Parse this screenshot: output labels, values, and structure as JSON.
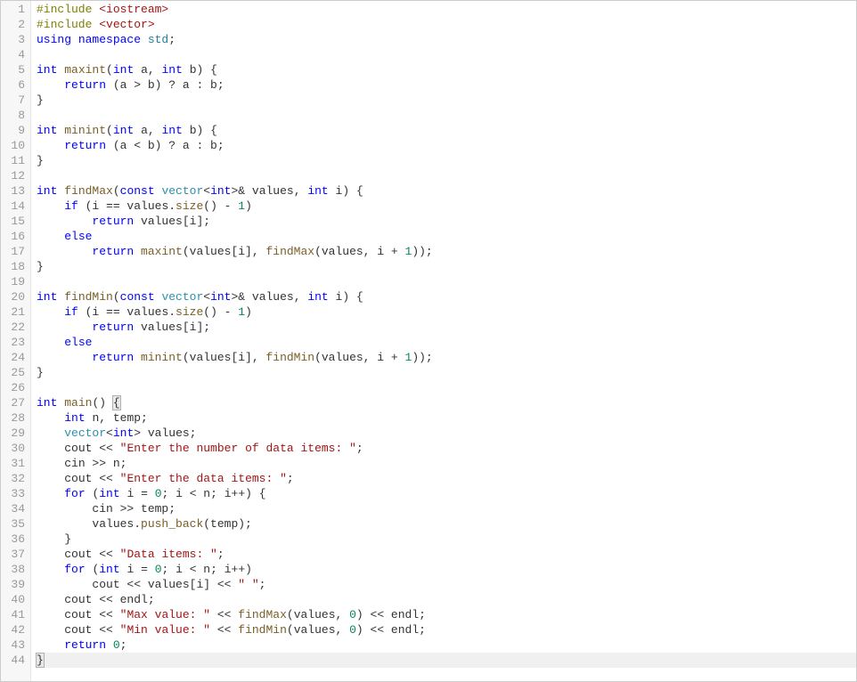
{
  "editor": {
    "line_count": 44,
    "highlighted_line": 44,
    "brace_match_lines": [
      27,
      44
    ],
    "lines": [
      [
        {
          "t": "#include ",
          "c": "preproc"
        },
        {
          "t": "<iostream>",
          "c": "string"
        }
      ],
      [
        {
          "t": "#include ",
          "c": "preproc"
        },
        {
          "t": "<vector>",
          "c": "string"
        }
      ],
      [
        {
          "t": "using ",
          "c": "keyword"
        },
        {
          "t": "namespace ",
          "c": "keyword"
        },
        {
          "t": "std",
          "c": "namespace"
        },
        {
          "t": ";",
          "c": "punct"
        }
      ],
      [],
      [
        {
          "t": "int ",
          "c": "keyword"
        },
        {
          "t": "maxint",
          "c": "func"
        },
        {
          "t": "(",
          "c": "paren"
        },
        {
          "t": "int ",
          "c": "keyword"
        },
        {
          "t": "a",
          "c": "ident"
        },
        {
          "t": ", ",
          "c": "punct"
        },
        {
          "t": "int ",
          "c": "keyword"
        },
        {
          "t": "b",
          "c": "ident"
        },
        {
          "t": ") {",
          "c": "paren"
        }
      ],
      [
        {
          "t": "    ",
          "c": "ident"
        },
        {
          "t": "return ",
          "c": "keyword"
        },
        {
          "t": "(a > b) ? a : b;",
          "c": "ident"
        }
      ],
      [
        {
          "t": "}",
          "c": "paren"
        }
      ],
      [],
      [
        {
          "t": "int ",
          "c": "keyword"
        },
        {
          "t": "minint",
          "c": "func"
        },
        {
          "t": "(",
          "c": "paren"
        },
        {
          "t": "int ",
          "c": "keyword"
        },
        {
          "t": "a",
          "c": "ident"
        },
        {
          "t": ", ",
          "c": "punct"
        },
        {
          "t": "int ",
          "c": "keyword"
        },
        {
          "t": "b",
          "c": "ident"
        },
        {
          "t": ") {",
          "c": "paren"
        }
      ],
      [
        {
          "t": "    ",
          "c": "ident"
        },
        {
          "t": "return ",
          "c": "keyword"
        },
        {
          "t": "(a < b) ? a : b;",
          "c": "ident"
        }
      ],
      [
        {
          "t": "}",
          "c": "paren"
        }
      ],
      [],
      [
        {
          "t": "int ",
          "c": "keyword"
        },
        {
          "t": "findMax",
          "c": "func"
        },
        {
          "t": "(",
          "c": "paren"
        },
        {
          "t": "const ",
          "c": "keyword"
        },
        {
          "t": "vector",
          "c": "type"
        },
        {
          "t": "<",
          "c": "op"
        },
        {
          "t": "int",
          "c": "keyword"
        },
        {
          "t": ">& ",
          "c": "op"
        },
        {
          "t": "values",
          "c": "ident"
        },
        {
          "t": ", ",
          "c": "punct"
        },
        {
          "t": "int ",
          "c": "keyword"
        },
        {
          "t": "i",
          "c": "ident"
        },
        {
          "t": ") {",
          "c": "paren"
        }
      ],
      [
        {
          "t": "    ",
          "c": "ident"
        },
        {
          "t": "if ",
          "c": "keyword"
        },
        {
          "t": "(i == values.",
          "c": "ident"
        },
        {
          "t": "size",
          "c": "func"
        },
        {
          "t": "() - ",
          "c": "ident"
        },
        {
          "t": "1",
          "c": "num"
        },
        {
          "t": ")",
          "c": "paren"
        }
      ],
      [
        {
          "t": "        ",
          "c": "ident"
        },
        {
          "t": "return ",
          "c": "keyword"
        },
        {
          "t": "values[i];",
          "c": "ident"
        }
      ],
      [
        {
          "t": "    ",
          "c": "ident"
        },
        {
          "t": "else",
          "c": "keyword"
        }
      ],
      [
        {
          "t": "        ",
          "c": "ident"
        },
        {
          "t": "return ",
          "c": "keyword"
        },
        {
          "t": "maxint",
          "c": "func"
        },
        {
          "t": "(values[i], ",
          "c": "ident"
        },
        {
          "t": "findMax",
          "c": "func"
        },
        {
          "t": "(values, i + ",
          "c": "ident"
        },
        {
          "t": "1",
          "c": "num"
        },
        {
          "t": "));",
          "c": "paren"
        }
      ],
      [
        {
          "t": "}",
          "c": "paren"
        }
      ],
      [],
      [
        {
          "t": "int ",
          "c": "keyword"
        },
        {
          "t": "findMin",
          "c": "func"
        },
        {
          "t": "(",
          "c": "paren"
        },
        {
          "t": "const ",
          "c": "keyword"
        },
        {
          "t": "vector",
          "c": "type"
        },
        {
          "t": "<",
          "c": "op"
        },
        {
          "t": "int",
          "c": "keyword"
        },
        {
          "t": ">& ",
          "c": "op"
        },
        {
          "t": "values",
          "c": "ident"
        },
        {
          "t": ", ",
          "c": "punct"
        },
        {
          "t": "int ",
          "c": "keyword"
        },
        {
          "t": "i",
          "c": "ident"
        },
        {
          "t": ") {",
          "c": "paren"
        }
      ],
      [
        {
          "t": "    ",
          "c": "ident"
        },
        {
          "t": "if ",
          "c": "keyword"
        },
        {
          "t": "(i == values.",
          "c": "ident"
        },
        {
          "t": "size",
          "c": "func"
        },
        {
          "t": "() - ",
          "c": "ident"
        },
        {
          "t": "1",
          "c": "num"
        },
        {
          "t": ")",
          "c": "paren"
        }
      ],
      [
        {
          "t": "        ",
          "c": "ident"
        },
        {
          "t": "return ",
          "c": "keyword"
        },
        {
          "t": "values[i];",
          "c": "ident"
        }
      ],
      [
        {
          "t": "    ",
          "c": "ident"
        },
        {
          "t": "else",
          "c": "keyword"
        }
      ],
      [
        {
          "t": "        ",
          "c": "ident"
        },
        {
          "t": "return ",
          "c": "keyword"
        },
        {
          "t": "minint",
          "c": "func"
        },
        {
          "t": "(values[i], ",
          "c": "ident"
        },
        {
          "t": "findMin",
          "c": "func"
        },
        {
          "t": "(values, i + ",
          "c": "ident"
        },
        {
          "t": "1",
          "c": "num"
        },
        {
          "t": "));",
          "c": "paren"
        }
      ],
      [
        {
          "t": "}",
          "c": "paren"
        }
      ],
      [],
      [
        {
          "t": "int ",
          "c": "keyword"
        },
        {
          "t": "main",
          "c": "func"
        },
        {
          "t": "() ",
          "c": "paren"
        },
        {
          "t": "{",
          "c": "paren",
          "bm": true
        }
      ],
      [
        {
          "t": "    ",
          "c": "ident"
        },
        {
          "t": "int ",
          "c": "keyword"
        },
        {
          "t": "n, temp;",
          "c": "ident"
        }
      ],
      [
        {
          "t": "    ",
          "c": "ident"
        },
        {
          "t": "vector",
          "c": "type"
        },
        {
          "t": "<",
          "c": "op"
        },
        {
          "t": "int",
          "c": "keyword"
        },
        {
          "t": "> ",
          "c": "op"
        },
        {
          "t": "values;",
          "c": "ident"
        }
      ],
      [
        {
          "t": "    ",
          "c": "ident"
        },
        {
          "t": "cout << ",
          "c": "ident"
        },
        {
          "t": "\"Enter the number of data items: \"",
          "c": "string"
        },
        {
          "t": ";",
          "c": "punct"
        }
      ],
      [
        {
          "t": "    ",
          "c": "ident"
        },
        {
          "t": "cin >> n;",
          "c": "ident"
        }
      ],
      [
        {
          "t": "    ",
          "c": "ident"
        },
        {
          "t": "cout << ",
          "c": "ident"
        },
        {
          "t": "\"Enter the data items: \"",
          "c": "string"
        },
        {
          "t": ";",
          "c": "punct"
        }
      ],
      [
        {
          "t": "    ",
          "c": "ident"
        },
        {
          "t": "for ",
          "c": "keyword"
        },
        {
          "t": "(",
          "c": "paren"
        },
        {
          "t": "int ",
          "c": "keyword"
        },
        {
          "t": "i = ",
          "c": "ident"
        },
        {
          "t": "0",
          "c": "num"
        },
        {
          "t": "; i < n; i++) {",
          "c": "ident"
        }
      ],
      [
        {
          "t": "        ",
          "c": "ident"
        },
        {
          "t": "cin >> temp;",
          "c": "ident"
        }
      ],
      [
        {
          "t": "        ",
          "c": "ident"
        },
        {
          "t": "values.",
          "c": "ident"
        },
        {
          "t": "push_back",
          "c": "func"
        },
        {
          "t": "(temp);",
          "c": "ident"
        }
      ],
      [
        {
          "t": "    }",
          "c": "paren"
        }
      ],
      [
        {
          "t": "    ",
          "c": "ident"
        },
        {
          "t": "cout << ",
          "c": "ident"
        },
        {
          "t": "\"Data items: \"",
          "c": "string"
        },
        {
          "t": ";",
          "c": "punct"
        }
      ],
      [
        {
          "t": "    ",
          "c": "ident"
        },
        {
          "t": "for ",
          "c": "keyword"
        },
        {
          "t": "(",
          "c": "paren"
        },
        {
          "t": "int ",
          "c": "keyword"
        },
        {
          "t": "i = ",
          "c": "ident"
        },
        {
          "t": "0",
          "c": "num"
        },
        {
          "t": "; i < n; i++)",
          "c": "ident"
        }
      ],
      [
        {
          "t": "        ",
          "c": "ident"
        },
        {
          "t": "cout << values[i] << ",
          "c": "ident"
        },
        {
          "t": "\" \"",
          "c": "string"
        },
        {
          "t": ";",
          "c": "punct"
        }
      ],
      [
        {
          "t": "    ",
          "c": "ident"
        },
        {
          "t": "cout << endl;",
          "c": "ident"
        }
      ],
      [
        {
          "t": "    ",
          "c": "ident"
        },
        {
          "t": "cout << ",
          "c": "ident"
        },
        {
          "t": "\"Max value: \"",
          "c": "string"
        },
        {
          "t": " << ",
          "c": "ident"
        },
        {
          "t": "findMax",
          "c": "func"
        },
        {
          "t": "(values, ",
          "c": "ident"
        },
        {
          "t": "0",
          "c": "num"
        },
        {
          "t": ") << endl;",
          "c": "ident"
        }
      ],
      [
        {
          "t": "    ",
          "c": "ident"
        },
        {
          "t": "cout << ",
          "c": "ident"
        },
        {
          "t": "\"Min value: \"",
          "c": "string"
        },
        {
          "t": " << ",
          "c": "ident"
        },
        {
          "t": "findMin",
          "c": "func"
        },
        {
          "t": "(values, ",
          "c": "ident"
        },
        {
          "t": "0",
          "c": "num"
        },
        {
          "t": ") << endl;",
          "c": "ident"
        }
      ],
      [
        {
          "t": "    ",
          "c": "ident"
        },
        {
          "t": "return ",
          "c": "keyword"
        },
        {
          "t": "0",
          "c": "num"
        },
        {
          "t": ";",
          "c": "punct"
        }
      ],
      [
        {
          "t": "}",
          "c": "paren",
          "bm": true
        }
      ]
    ]
  }
}
